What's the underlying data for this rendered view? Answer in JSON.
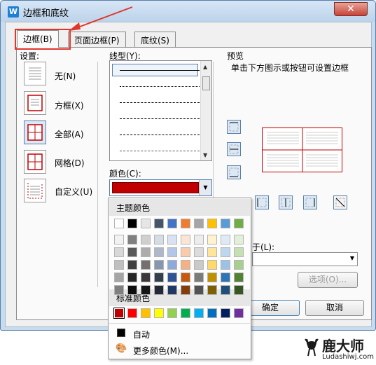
{
  "window": {
    "title": "边框和底纹",
    "app_icon": "W",
    "close": "✕"
  },
  "tabs": [
    {
      "label": "边框(B)"
    },
    {
      "label": "页面边框(P)"
    },
    {
      "label": "底纹(S)"
    }
  ],
  "settings": {
    "label": "设置:",
    "items": [
      {
        "label": "无(N)"
      },
      {
        "label": "方框(X)"
      },
      {
        "label": "全部(A)"
      },
      {
        "label": "网格(D)"
      },
      {
        "label": "自定义(U)"
      }
    ]
  },
  "line_style": {
    "label": "线型(Y):"
  },
  "color": {
    "label": "颜色(C):",
    "value": "#c00000"
  },
  "preview": {
    "label": "预览",
    "hint": "单击下方图示或按钮可设置边框"
  },
  "apply_to": {
    "label": "应用于(L):",
    "value": ""
  },
  "buttons": {
    "options": "选项(O)...",
    "ok": "确定",
    "cancel": "取消"
  },
  "color_popup": {
    "theme_header": "主题颜色",
    "theme_top_row": [
      "#ffffff",
      "#000000",
      "#e7e6e6",
      "#44546a",
      "#4472c4",
      "#ed7d31",
      "#a5a5a5",
      "#ffc000",
      "#5b9bd5",
      "#70ad47"
    ],
    "theme_shades": [
      [
        "#f2f2f2",
        "#808080",
        "#d0cece",
        "#d6dce4",
        "#d9e2f3",
        "#fbe5d5",
        "#ededed",
        "#fff2cc",
        "#deebf6",
        "#e2efd9"
      ],
      [
        "#d8d8d8",
        "#595959",
        "#aeabab",
        "#adb9ca",
        "#b4c6e7",
        "#f7cbac",
        "#dbdbdb",
        "#fee599",
        "#bdd7ee",
        "#c5e0b3"
      ],
      [
        "#bfbfbf",
        "#404040",
        "#757070",
        "#8496b0",
        "#8eaadb",
        "#f4b183",
        "#c9c9c9",
        "#ffd965",
        "#9cc3e5",
        "#a8d08d"
      ],
      [
        "#a5a5a5",
        "#262626",
        "#3a3838",
        "#323f4f",
        "#2f5496",
        "#c55a11",
        "#7b7b7b",
        "#bf9000",
        "#2e75b5",
        "#538135"
      ],
      [
        "#7f7f7f",
        "#0d0d0d",
        "#171616",
        "#222a35",
        "#1f3864",
        "#833c0b",
        "#525252",
        "#7f6000",
        "#1e4e79",
        "#375623"
      ]
    ],
    "standard_header": "标准颜色",
    "standard": [
      "#c00000",
      "#ff0000",
      "#ffc000",
      "#ffff00",
      "#92d050",
      "#00b050",
      "#00b0f0",
      "#0070c0",
      "#002060",
      "#7030a0"
    ],
    "auto_label": "自动",
    "more_label": "更多颜色(M)..."
  },
  "watermark": {
    "brand": "鹿大师",
    "url": "Ludashiwj.com"
  }
}
